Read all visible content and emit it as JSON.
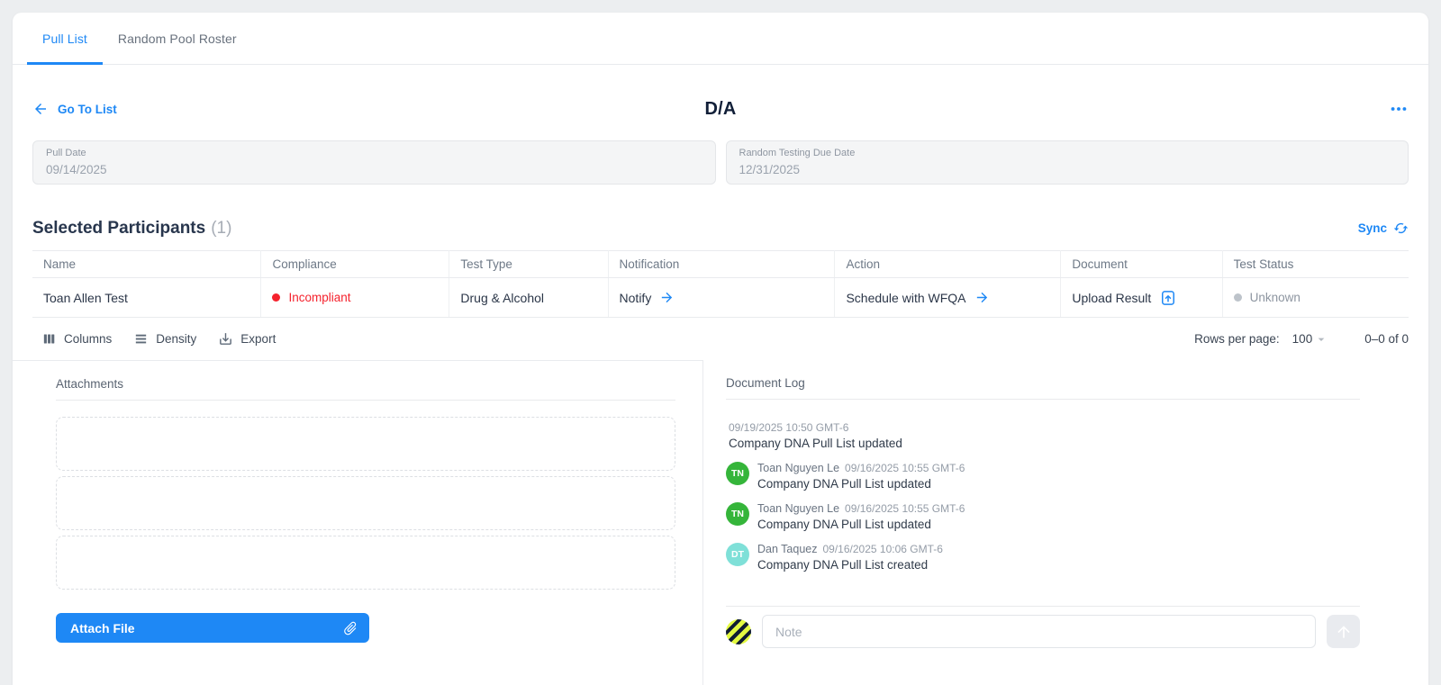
{
  "tabs": {
    "items": [
      {
        "label": "Pull List"
      },
      {
        "label": "Random Pool Roster"
      }
    ],
    "active": "Pull List"
  },
  "header": {
    "back_link": "Go To List",
    "title": "D/A"
  },
  "fields": {
    "pull_date": {
      "label": "Pull Date",
      "value": "09/14/2025"
    },
    "due_date": {
      "label": "Random Testing Due Date",
      "value": "12/31/2025"
    }
  },
  "participants": {
    "title": "Selected Participants",
    "count": "(1)",
    "sync_label": "Sync",
    "table": {
      "columns": [
        "Name",
        "Compliance",
        "Test Type",
        "Notification",
        "Action",
        "Document",
        "Test Status"
      ],
      "row": {
        "name": "Toan Allen Test",
        "compliance": "Incompliant",
        "test_type": "Drug & Alcohol",
        "notification": "Notify",
        "action": "Schedule with WFQA",
        "document": "Upload Result",
        "test_status": "Unknown"
      }
    },
    "toolbar": {
      "columns_label": "Columns",
      "density_label": "Density",
      "export_label": "Export"
    },
    "pagination": {
      "rows_per_page_label": "Rows per page:",
      "rows_per_page_value": "100",
      "range_label": "0–0 of 0"
    }
  },
  "attachments": {
    "title": "Attachments",
    "attach_button_label": "Attach File",
    "empty_slot_count": 3
  },
  "document_log": {
    "title": "Document Log",
    "entries": [
      {
        "timestamp": "09/19/2025 10:50 GMT-6",
        "message": "Company DNA Pull List updated"
      },
      {
        "initials": "TN",
        "user": "Toan Nguyen Le",
        "timestamp": "09/16/2025 10:55 GMT-6",
        "message": "Company DNA Pull List updated"
      },
      {
        "initials": "TN",
        "user": "Toan Nguyen Le",
        "timestamp": "09/16/2025 10:55 GMT-6",
        "message": "Company DNA Pull List updated"
      },
      {
        "initials": "DT",
        "user": "Dan Taquez",
        "timestamp": "09/16/2025 10:06 GMT-6",
        "message": "Company DNA Pull List created"
      }
    ],
    "note_input": {
      "placeholder": "Note",
      "value": ""
    }
  },
  "icons": {
    "back": "arrow-left-icon",
    "menu": "more-horizontal-icon",
    "sync": "sync-icon",
    "notify": "arrow-right-icon",
    "schedule": "arrow-right-icon",
    "upload": "file-upload-icon",
    "columns": "columns-icon",
    "density": "density-icon",
    "export": "download-icon",
    "rows_caret": "caret-down-icon",
    "attach": "paperclip-icon",
    "send": "arrow-up-icon"
  },
  "colors": {
    "accent_blue": "#1e88f5",
    "error_red": "#f5222d",
    "avatar_green": "#35b53a",
    "avatar_teal": "#7fe0d8",
    "note_avatar_lime": "#e3f942",
    "note_avatar_navy": "#101c33",
    "title_navy": "#111f38",
    "page_background": "#eceef0"
  }
}
